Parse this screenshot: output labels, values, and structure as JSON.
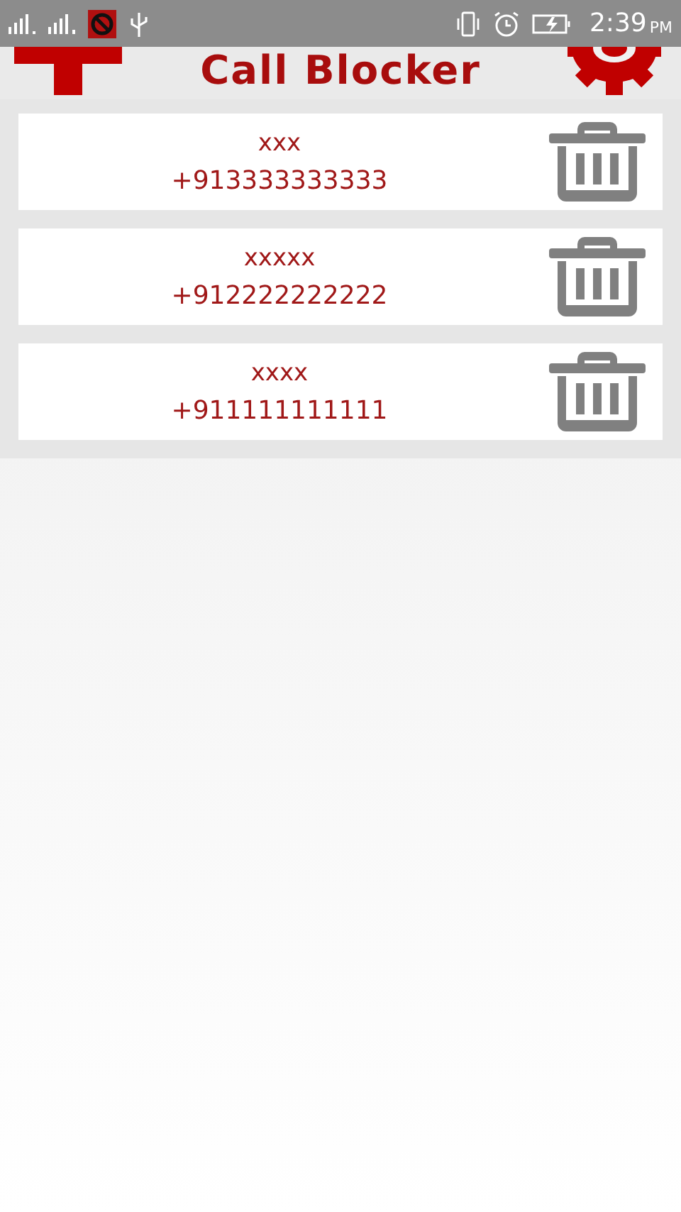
{
  "status_bar": {
    "time": "2:39",
    "meridiem": "PM"
  },
  "app_bar": {
    "title": "Call Blocker"
  },
  "blocked_contacts": [
    {
      "name": "xxx",
      "number": "+913333333333"
    },
    {
      "name": "xxxxx",
      "number": "+912222222222"
    },
    {
      "name": "xxxx",
      "number": "+911111111111"
    }
  ]
}
